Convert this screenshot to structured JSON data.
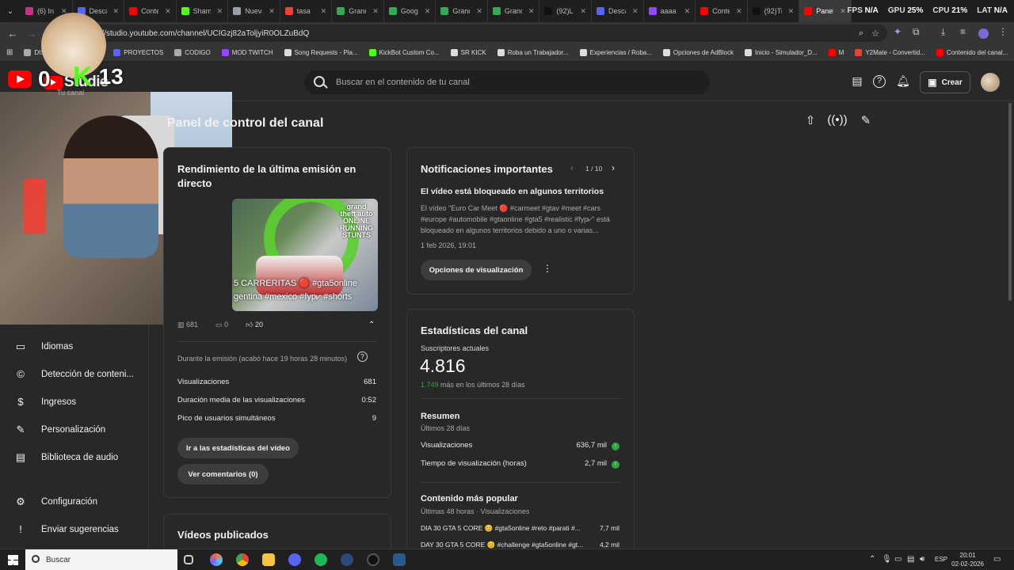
{
  "browser": {
    "tabs": [
      {
        "label": "(6) In",
        "color": "#c13584"
      },
      {
        "label": "Desca",
        "color": "#5865f2"
      },
      {
        "label": "Conte",
        "color": "#ff0000"
      },
      {
        "label": "Sham",
        "color": "#53fc18"
      },
      {
        "label": "Nueva",
        "color": "#9aa0a6"
      },
      {
        "label": "tasa",
        "color": "#ea4335"
      },
      {
        "label": "Grand",
        "color": "#34a853"
      },
      {
        "label": "Googl",
        "color": "#34a853"
      },
      {
        "label": "Grand",
        "color": "#34a853"
      },
      {
        "label": "Grand",
        "color": "#34a853"
      },
      {
        "label": "(92)Li",
        "color": "#111111"
      },
      {
        "label": "Desca",
        "color": "#5865f2"
      },
      {
        "label": "aaaa",
        "color": "#9146ff"
      },
      {
        "label": "Conte",
        "color": "#ff0000"
      },
      {
        "label": "(92)Ti",
        "color": "#111111"
      },
      {
        "label": "Panel",
        "color": "#ff0000"
      }
    ],
    "hud": {
      "fps_label": "FPS",
      "fps": "N/A",
      "gpu_label": "GPU",
      "gpu": "25%",
      "cpu_label": "CPU",
      "cpu": "21%",
      "lat_label": "LAT",
      "lat": "N/A"
    },
    "url": "https://studio.youtube.com/channel/UCIGzj82aToljyiR0OLZuBdQ",
    "bookmarks": [
      {
        "label": "DISPOSITIVOS VERSE",
        "color": "#aaaaaa"
      },
      {
        "label": "PROYECTOS",
        "color": "#5865f2"
      },
      {
        "label": "CODIGO",
        "color": "#aaaaaa"
      },
      {
        "label": "MOD TWITCH",
        "color": "#9146ff"
      },
      {
        "label": "Song Requests - Pla...",
        "color": "#dddddd"
      },
      {
        "label": "KickBot Custom Co...",
        "color": "#53fc18"
      },
      {
        "label": "SR KICK",
        "color": "#dddddd"
      },
      {
        "label": "Roba un Trabajador...",
        "color": "#dddddd"
      },
      {
        "label": "Experiencias / Roba...",
        "color": "#dddddd"
      },
      {
        "label": "Opciones de AdBlock",
        "color": "#dddddd"
      },
      {
        "label": "Inicio - Simulador_D...",
        "color": "#dddddd"
      },
      {
        "label": "M",
        "color": "#ff0000"
      },
      {
        "label": "Y2Mate - Convertid...",
        "color": "#ea4335"
      },
      {
        "label": "Contenido del canal...",
        "color": "#ff0000"
      }
    ]
  },
  "studio": {
    "logo_text": "Studio",
    "search_placeholder": "Buscar en el contenido de tu canal",
    "create_label": "Crear"
  },
  "overlay": {
    "yt_count": "0",
    "kick_count": "13",
    "channel_label": "Tu canal"
  },
  "sidebar": {
    "items": [
      {
        "label": "Idiomas",
        "icon": "subtitles-icon",
        "glyph": "▭"
      },
      {
        "label": "Detección de conteni...",
        "icon": "copyright-icon",
        "glyph": "©"
      },
      {
        "label": "Ingresos",
        "icon": "dollar-icon",
        "glyph": "$"
      },
      {
        "label": "Personalización",
        "icon": "wand-icon",
        "glyph": "✎"
      },
      {
        "label": "Biblioteca de audio",
        "icon": "audio-library-icon",
        "glyph": "▤"
      },
      {
        "label": "Configuración",
        "icon": "gear-icon",
        "glyph": "⚙"
      },
      {
        "label": "Enviar sugerencias",
        "icon": "feedback-icon",
        "glyph": "!"
      }
    ]
  },
  "page": {
    "title": "Panel de control del canal"
  },
  "live_card": {
    "title": "Rendimiento de la última emisión en directo",
    "thumb_text": "5 CARRERITAS 🔴 #gta5online gentina #mexico #fyp⩗ #shorts",
    "thumb_logo": "grand theft auto ONLINE RUNNING STUNTS",
    "stat_views": "681",
    "stat_comments": "0",
    "stat_likes": "20",
    "during": "Durante la emisión (acabó hace 19 horas 28 minutos)",
    "rows": [
      {
        "label": "Visualizaciones",
        "value": "681"
      },
      {
        "label": "Duración media de las visualizaciones",
        "value": "0:52"
      },
      {
        "label": "Pico de usuarios simultáneos",
        "value": "9"
      }
    ],
    "btn_stats": "Ir a las estadísticas del vídeo",
    "btn_comments": "Ver comentarios (0)"
  },
  "videos_card": {
    "title": "Vídeos publicados"
  },
  "notif_card": {
    "title": "Notificaciones importantes",
    "pager": "1 / 10",
    "heading": "El vídeo está bloqueado en algunos territorios",
    "body": "El vídeo \"Euro Car Meet 🔴 #carmeet #gtav #meet #cars #europe #automobile #gtaonline #gta5 #realistic #fyp⩗\" está bloqueado en algunos territorios debido a uno o varias...",
    "date": "1 feb 2026, 19:01",
    "button": "Opciones de visualización"
  },
  "channel_card": {
    "title": "Estadísticas del canal",
    "subs_label": "Suscriptores actuales",
    "subs_value": "4.816",
    "subs_delta": "1.749",
    "subs_delta_text": "más en los últimos 28 días",
    "summary_title": "Resumen",
    "summary_period": "Últimos 28 días",
    "summary_rows": [
      {
        "label": "Visualizaciones",
        "value": "636,7 mil"
      },
      {
        "label": "Tiempo de visualización (horas)",
        "value": "2,7 mil"
      }
    ],
    "popular_title": "Contenido más popular",
    "popular_period": "Últimas 48 horas · Visualizaciones",
    "popular_rows": [
      {
        "label": "DIA 30 GTA 5 CORE 😊 #gta5online #reto #parati #...",
        "value": "7,7 mil"
      },
      {
        "label": "DAY 30 GTA 5 CORE 😊 #challenge #gta5online #gt...",
        "value": "4,2 mil"
      }
    ]
  },
  "taskbar": {
    "search": "Buscar",
    "lang": "ESP",
    "time": "20:01",
    "date": "02-02-2026"
  },
  "colors": {
    "accent_red": "#ff0000",
    "kick_green": "#53fc18",
    "up_green": "#2ba640"
  }
}
